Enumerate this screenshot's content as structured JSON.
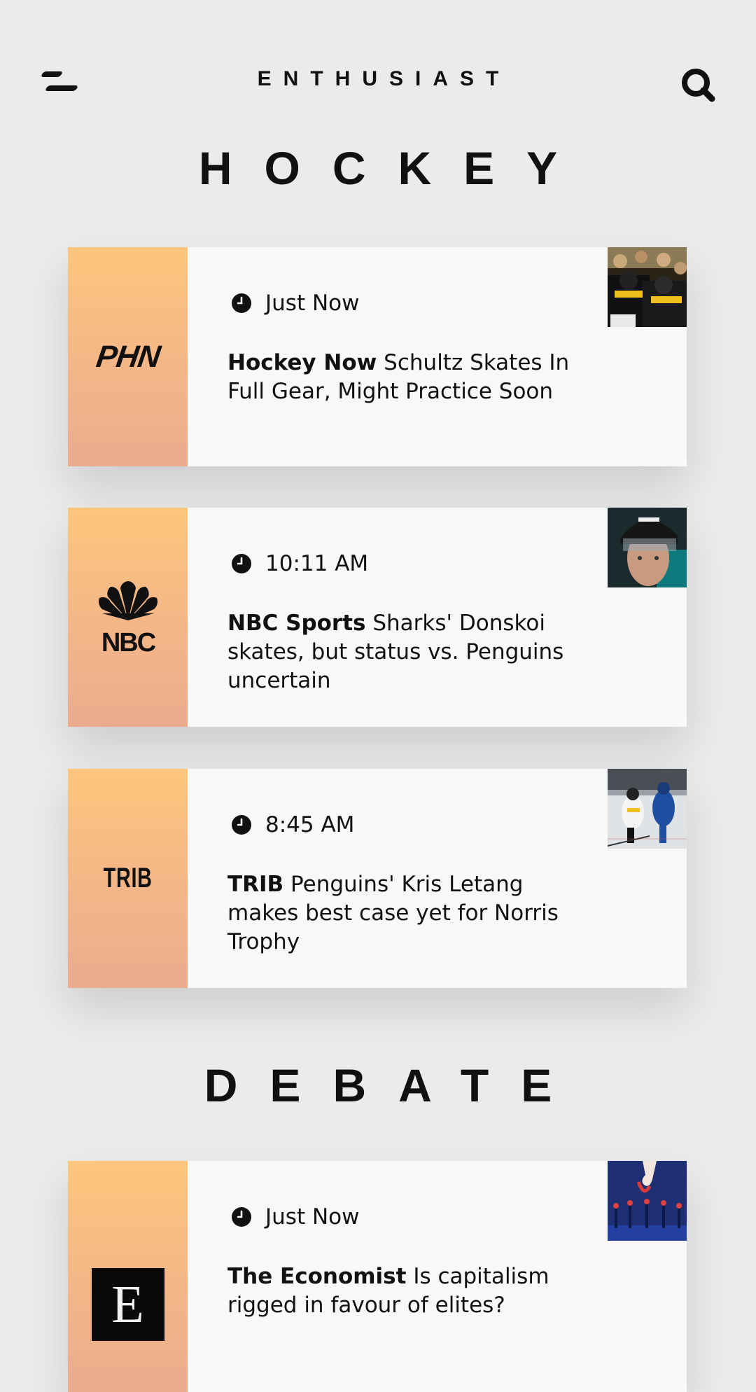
{
  "header": {
    "brand": "ENTHUSIAST",
    "menu_icon": "menu-icon",
    "search_icon": "search-icon"
  },
  "sections": [
    {
      "title": "HOCKEY",
      "cards": [
        {
          "logo": "PHN",
          "time": "Just Now",
          "source": "Hockey Now",
          "title": "Schultz Skates In Full Gear, Might Practice Soon",
          "thumb": "penguins-team-photo"
        },
        {
          "logo": "NBC",
          "time": "10:11 AM",
          "source": "NBC Sports",
          "title": "Sharks' Donskoi skates, but status vs. Penguins uncertain",
          "thumb": "player-helmet-photo"
        },
        {
          "logo": "TRIB",
          "time": "8:45 AM",
          "source": "TRIB",
          "title": "Penguins' Kris Letang makes best case yet for Norris Trophy",
          "thumb": "hockey-game-photo"
        }
      ]
    },
    {
      "title": "DEBATE",
      "cards": [
        {
          "logo": "E",
          "time": "Just Now",
          "source": "The Economist",
          "title": "Is capitalism rigged in favour of elites?",
          "thumb": "capitalism-illustration"
        }
      ]
    }
  ],
  "colors": {
    "background": "#ebebeb",
    "card": "#f8f8f8",
    "logo_gradient_top": "#fdc67c",
    "logo_gradient_bottom": "#ebab8d",
    "text": "#111111"
  }
}
